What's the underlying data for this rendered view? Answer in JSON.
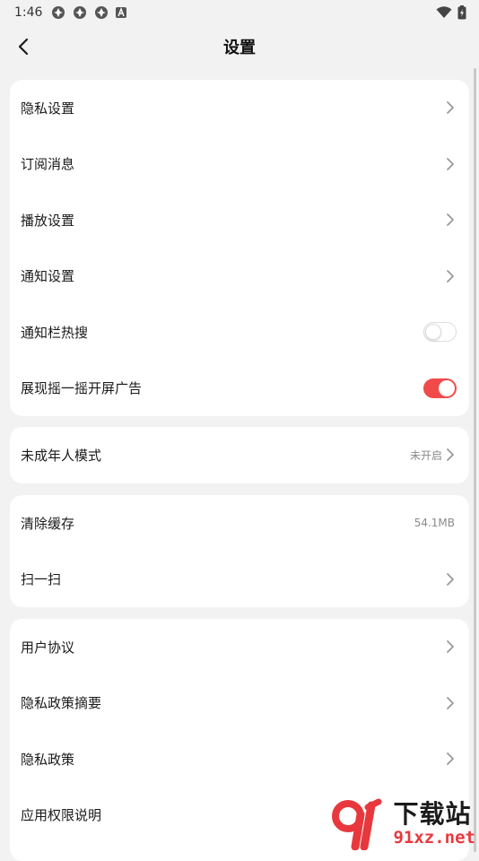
{
  "status_bar": {
    "time": "1:46"
  },
  "header": {
    "title": "设置"
  },
  "groups": [
    {
      "items": [
        {
          "label": "隐私设置"
        },
        {
          "label": "订阅消息"
        },
        {
          "label": "播放设置"
        },
        {
          "label": "通知设置"
        },
        {
          "label": "通知栏热搜",
          "toggle": false
        },
        {
          "label": "展现摇一摇开屏广告",
          "toggle": true
        }
      ]
    },
    {
      "items": [
        {
          "label": "未成年人模式",
          "value": "未开启"
        }
      ]
    },
    {
      "items": [
        {
          "label": "清除缓存",
          "value": "54.1MB"
        },
        {
          "label": "扫一扫"
        }
      ]
    },
    {
      "items": [
        {
          "label": "用户协议"
        },
        {
          "label": "隐私政策摘要"
        },
        {
          "label": "隐私政策"
        },
        {
          "label": "应用权限说明"
        }
      ]
    }
  ],
  "watermark": {
    "brand": "下载站",
    "url": "91xz.net"
  },
  "colors": {
    "accent": "#f04a4a",
    "background": "#f2f2f2",
    "card": "#ffffff"
  }
}
